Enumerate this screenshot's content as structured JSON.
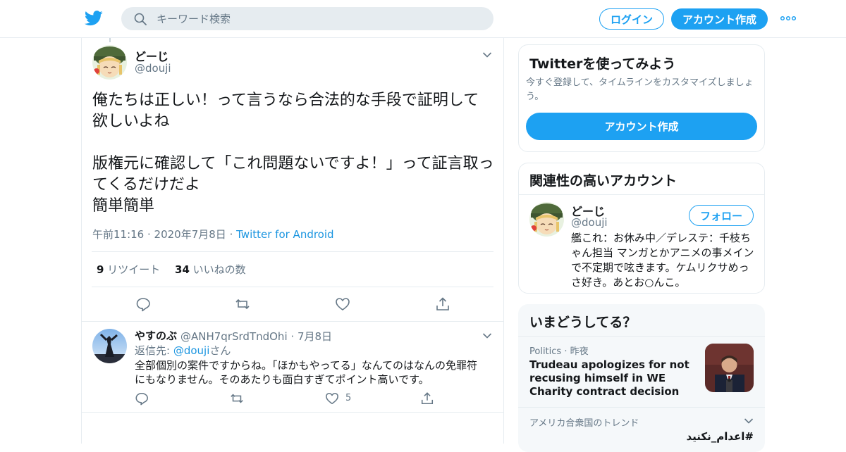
{
  "header": {
    "search_placeholder": "キーワード検索",
    "login_label": "ログイン",
    "signup_label": "アカウント作成"
  },
  "tweet": {
    "author_name": "どーじ",
    "author_handle": "@douji",
    "text_line1": "俺たちは正しい！って言うなら合法的な手段で証明して欲しいよね",
    "text_line2": "版権元に確認して「これ問題ないですよ！」って証言取ってくるだけだよ\n簡単簡単",
    "time": "午前11:16",
    "date": "2020年7月8日",
    "source": "Twitter for Android",
    "retweet_count": "9",
    "retweet_label": "リツイート",
    "like_count": "34",
    "like_label": "いいねの数"
  },
  "reply": {
    "author_name": "やすのぶ",
    "author_handle": "@ANH7qrSrdTndOhi",
    "date": "7月8日",
    "reply_to_prefix": "返信先: ",
    "reply_to_handle": "@douji",
    "reply_to_suffix": "さん",
    "text": "全部個別の案件ですからね。「ほかもやってる」なんてのはなんの免罪符にもなりません。そのあたりも面白すぎてポイント高いです。",
    "like_count": "5"
  },
  "sidebar": {
    "signup_card": {
      "title": "Twitterを使ってみよう",
      "subtitle": "今すぐ登録して、タイムラインをカスタマイズしましょう。",
      "button_label": "アカウント作成"
    },
    "related": {
      "title": "関連性の高いアカウント",
      "name": "どーじ",
      "handle": "@douji",
      "follow_label": "フォロー",
      "bio": "艦これ：お休み中／デレステ：千枝ちゃん担当 マンガとかアニメの事メインで不定期で呟きます。ケムリクサめっさ好き。あとお○んこ。"
    },
    "trends": {
      "title": "いまどうしてる？",
      "item1_category": "Politics",
      "item1_time": "昨夜",
      "item1_title": "Trudeau apologizes for not recusing himself in WE Charity contract decision",
      "item2_location": "アメリカ合衆国のトレンド",
      "item2_tag": "#اعدام_نكنيد"
    }
  },
  "colors": {
    "brand_blue": "#1da1f2",
    "link_blue": "#1b95e0",
    "muted_text": "#657786",
    "border": "#e6ecf0"
  }
}
